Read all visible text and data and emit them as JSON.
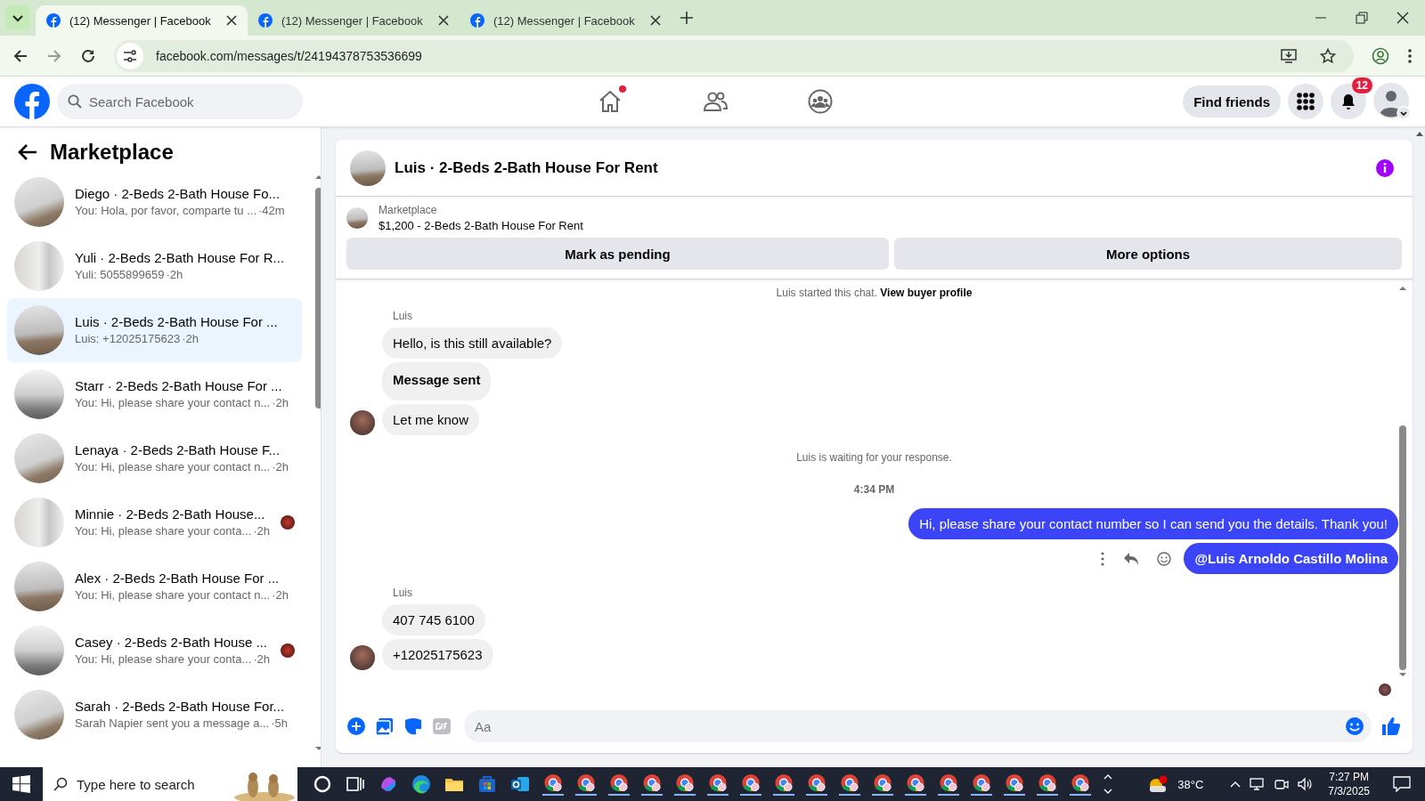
{
  "browser": {
    "tabs": [
      {
        "label": "(12) Messenger | Facebook",
        "selected": true
      },
      {
        "label": "(12) Messenger | Facebook",
        "selected": false
      },
      {
        "label": "(12) Messenger | Facebook",
        "selected": false
      }
    ],
    "url": "facebook.com/messages/t/24194378753536699"
  },
  "header": {
    "search": {
      "placeholder": "Search Facebook"
    },
    "home_dot": true,
    "find_friends": "Find friends",
    "notifications": "12"
  },
  "sidebar": {
    "title": "Marketplace",
    "conversations": [
      {
        "name": "Diego · 2-Beds 2-Bath House Fo...",
        "preview": "You: Hola, por favor, comparte tu ...",
        "time": "·42m",
        "selected": false,
        "seen": false
      },
      {
        "name": "Yuli · 2-Beds 2-Bath House For R...",
        "preview": "Yuli: 5055899659",
        "time": "·2h",
        "selected": false,
        "seen": false
      },
      {
        "name": "Luis · 2-Beds 2-Bath House For ...",
        "preview": "Luis: +12025175623",
        "time": "·2h",
        "selected": true,
        "seen": false
      },
      {
        "name": "Starr · 2-Beds 2-Bath House For ...",
        "preview": "You: Hi, please share your contact n...",
        "time": "·2h",
        "selected": false,
        "seen": false
      },
      {
        "name": "Lenaya · 2-Beds 2-Bath House F...",
        "preview": "You: Hi, please share your contact n...",
        "time": "·2h",
        "selected": false,
        "seen": false
      },
      {
        "name": "Minnie · 2-Beds 2-Bath House...",
        "preview": "You: Hi, please share your conta...",
        "time": "·2h",
        "selected": false,
        "seen": true
      },
      {
        "name": "Alex · 2-Beds 2-Bath House For ...",
        "preview": "You: Hi, please share your contact n...",
        "time": "·2h",
        "selected": false,
        "seen": false
      },
      {
        "name": "Casey · 2-Beds 2-Bath House ...",
        "preview": "You: Hi, please share your conta...",
        "time": "·2h",
        "selected": false,
        "seen": true
      },
      {
        "name": "Sarah · 2-Beds 2-Bath House For...",
        "preview": "Sarah Napier sent you a message a...",
        "time": "·5h",
        "selected": false,
        "seen": false
      }
    ]
  },
  "chat": {
    "title": "Luis · 2-Beds 2-Bath House For Rent",
    "listing": {
      "label": "Marketplace",
      "item": "$1,200 - 2-Beds 2-Bath House For Rent"
    },
    "buttons": [
      "Mark as pending",
      "More options"
    ],
    "messages": [
      {
        "kind": "notice",
        "text": "Luis started this chat.",
        "link": "View buyer profile"
      },
      {
        "kind": "incoming",
        "sender": "Luis",
        "bubbles": [
          {
            "text": "Hello, is this still available?",
            "bold": false
          },
          {
            "text": "Message sent",
            "bold": true
          },
          {
            "text": "Let me know",
            "bold": false
          }
        ]
      },
      {
        "kind": "notice",
        "text": "Luis is waiting for your response."
      },
      {
        "kind": "time",
        "text": "4:34 PM"
      },
      {
        "kind": "outgoing",
        "bubbles": [
          {
            "text": "Hi, please share your contact number so I can send you the details. Thank you!",
            "bold": false
          },
          {
            "text": "@Luis Arnoldo Castillo Molina",
            "bold": true,
            "actions": true
          }
        ]
      },
      {
        "kind": "incoming",
        "sender": "Luis",
        "bubbles": [
          {
            "text": "407 745 6100",
            "bold": false
          },
          {
            "text": "+12025175623",
            "bold": false
          }
        ]
      }
    ],
    "composer": {
      "placeholder": "Aa"
    }
  },
  "taskbar": {
    "search": {
      "placeholder": "Type here to search"
    },
    "apps": [
      {
        "kind": "cortana"
      },
      {
        "kind": "taskview"
      },
      {
        "kind": "copilot"
      },
      {
        "kind": "edge"
      },
      {
        "kind": "folder"
      },
      {
        "kind": "store"
      },
      {
        "kind": "outlook"
      },
      {
        "kind": "chrome"
      },
      {
        "kind": "chrome"
      },
      {
        "kind": "chrome"
      },
      {
        "kind": "chrome"
      },
      {
        "kind": "chrome"
      },
      {
        "kind": "chrome"
      },
      {
        "kind": "chrome"
      },
      {
        "kind": "chrome"
      },
      {
        "kind": "chrome"
      },
      {
        "kind": "chrome"
      },
      {
        "kind": "chrome"
      },
      {
        "kind": "chrome"
      },
      {
        "kind": "chrome"
      },
      {
        "kind": "chrome"
      },
      {
        "kind": "chrome"
      },
      {
        "kind": "chrome"
      },
      {
        "kind": "chrome"
      }
    ],
    "temperature": "38°C",
    "time": "7:27 PM",
    "date": "7/3/2025"
  }
}
